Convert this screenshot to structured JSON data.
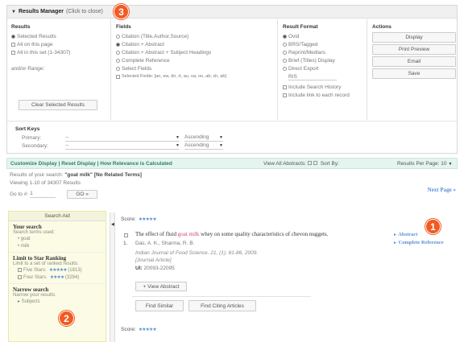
{
  "results_manager": {
    "title": "Results Manager",
    "close_label": "(Click to close)",
    "badge": "3"
  },
  "results_col": {
    "title": "Results",
    "options": [
      {
        "label": "Selected Results",
        "checked": true
      },
      {
        "label": "All on this page",
        "checked": false
      },
      {
        "label": "All in this set (1-34307)",
        "checked": false
      }
    ],
    "range_label": "and/or Range:",
    "clear_button": "Clear Selected Results"
  },
  "fields_col": {
    "title": "Fields",
    "options": [
      {
        "label": "Citation (Title,Author,Source)",
        "checked": false
      },
      {
        "label": "Citation + Abstract",
        "checked": true
      },
      {
        "label": "Citation + Abstract + Subject Headings",
        "checked": false
      },
      {
        "label": "Complete Reference",
        "checked": false
      },
      {
        "label": "Select Fields",
        "checked": false
      }
    ],
    "selected_fields_label": "Selected Fields: [an, ew, dn, rt, au, oa, oo, ab, sh, ab]"
  },
  "format_col": {
    "title": "Result Format",
    "options": [
      {
        "label": "Ovid",
        "checked": true
      },
      {
        "label": "BRS/Tagged",
        "checked": false
      },
      {
        "label": "Reprint/Medlars",
        "checked": false
      },
      {
        "label": "Brief (Titles) Display",
        "checked": false
      },
      {
        "label": "Direct Export",
        "checked": false
      }
    ],
    "direct_export_value": "RIS",
    "checkboxes": [
      "Include Search History",
      "Include link to each record"
    ]
  },
  "actions_col": {
    "title": "Actions",
    "buttons": [
      "Display",
      "Print Preview",
      "Email",
      "Save"
    ]
  },
  "sort": {
    "title": "Sort Keys",
    "primary_label": "Primary:",
    "primary_value": "--",
    "primary_order": "Ascending",
    "secondary_label": "Secondary:",
    "secondary_value": "--",
    "secondary_order": "Ascending"
  },
  "toolbar": {
    "links": "Customize Display | Reset Display | How Relevance is Calculated",
    "view_all": "View All Abstracts:",
    "sort_by": "Sort By:",
    "per_page_label": "Results Per Page:",
    "per_page_value": "10"
  },
  "results_info": {
    "prefix": "Results of your search:",
    "query": "\"goat milk\"",
    "suffix": "[No Related Terms]",
    "viewing": "Viewing 1-10 of 34307 Results",
    "goto_label": "Go to #:",
    "goto_value": "1",
    "go_button": "GO",
    "next_page": "Next Page"
  },
  "sidebar": {
    "tab": "Search Aid",
    "your_search_title": "Your search",
    "your_search_sub": "Search terms used:",
    "terms": [
      "goat",
      "milk"
    ],
    "star_title": "Limit to Star Ranking",
    "star_sub": "Limit to a set of ranked results:",
    "star_items": [
      {
        "label": "Five Stars:",
        "count": "(1813)"
      },
      {
        "label": "Four Stars:",
        "count": "(3294)"
      }
    ],
    "narrow_title": "Narrow search",
    "narrow_sub": "Narrow your results:",
    "narrow_items": [
      "Subjects"
    ],
    "badge": "2"
  },
  "result": {
    "score_label": "Score:",
    "number": "1.",
    "title_pre": "The effect of fluid",
    "title_hl": "goat milk",
    "title_post": "whey on some quality characteristics of chevon nuggets.",
    "authors": "Das, A. K., Sharma, R. B.",
    "journal": "Indian Journal of Food Science. 21, (1): 81-86, 2009.",
    "pubtype": "[Journal Article]",
    "ui_label": "UI:",
    "ui_value": "20093-22095",
    "view_abstract": "View Abstract",
    "find_similar": "Find Similar",
    "find_citing": "Find Citing Articles",
    "abstract_link": "Abstract",
    "complete_ref_link": "Complete Reference",
    "badge": "1",
    "next_score_label": "Score:"
  },
  "colors": {
    "accent_green": "#2f7d62",
    "link_blue": "#5b8fd6",
    "highlight": "#d0457a",
    "badge": "#f15a22"
  }
}
